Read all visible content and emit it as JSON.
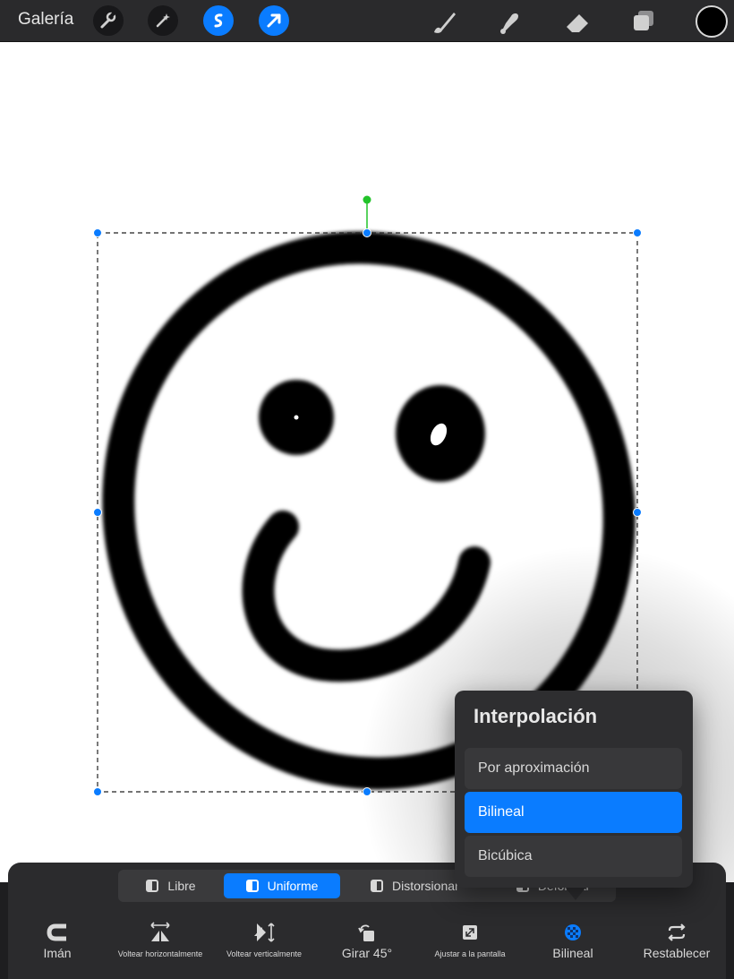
{
  "topbar": {
    "gallery_label": "Galería",
    "icons": [
      "wrench-icon",
      "magic-wand-icon",
      "selection-s-icon",
      "transform-arrow-icon",
      "brush-icon",
      "smudge-icon",
      "eraser-icon",
      "layers-icon"
    ],
    "current_color": "#000000"
  },
  "transform": {
    "modes": [
      {
        "label": "Libre",
        "active": false
      },
      {
        "label": "Uniforme",
        "active": true
      },
      {
        "label": "Distorsionar",
        "active": false
      },
      {
        "label": "Deformar",
        "active": false
      }
    ],
    "actions": [
      {
        "label": "Imán",
        "icon": "magnet-icon"
      },
      {
        "label": "Voltear horizontalmente",
        "icon": "flip-horizontal-icon"
      },
      {
        "label": "Voltear verticalmente",
        "icon": "flip-vertical-icon"
      },
      {
        "label": "Girar 45°",
        "icon": "rotate-icon"
      },
      {
        "label": "Ajustar a la pantalla",
        "icon": "fit-screen-icon"
      },
      {
        "label": "Bilineal",
        "icon": "interpolation-icon"
      },
      {
        "label": "Restablecer",
        "icon": "reset-icon"
      }
    ]
  },
  "interpolation_popover": {
    "title": "Interpolación",
    "options": [
      {
        "label": "Por aproximación",
        "selected": false
      },
      {
        "label": "Bilineal",
        "selected": true
      },
      {
        "label": "Bicúbica",
        "selected": false
      }
    ]
  },
  "colors": {
    "accent": "#0a7cff",
    "toolbar_bg": "#2a2a2c",
    "rotation_handle": "#22c32a"
  }
}
